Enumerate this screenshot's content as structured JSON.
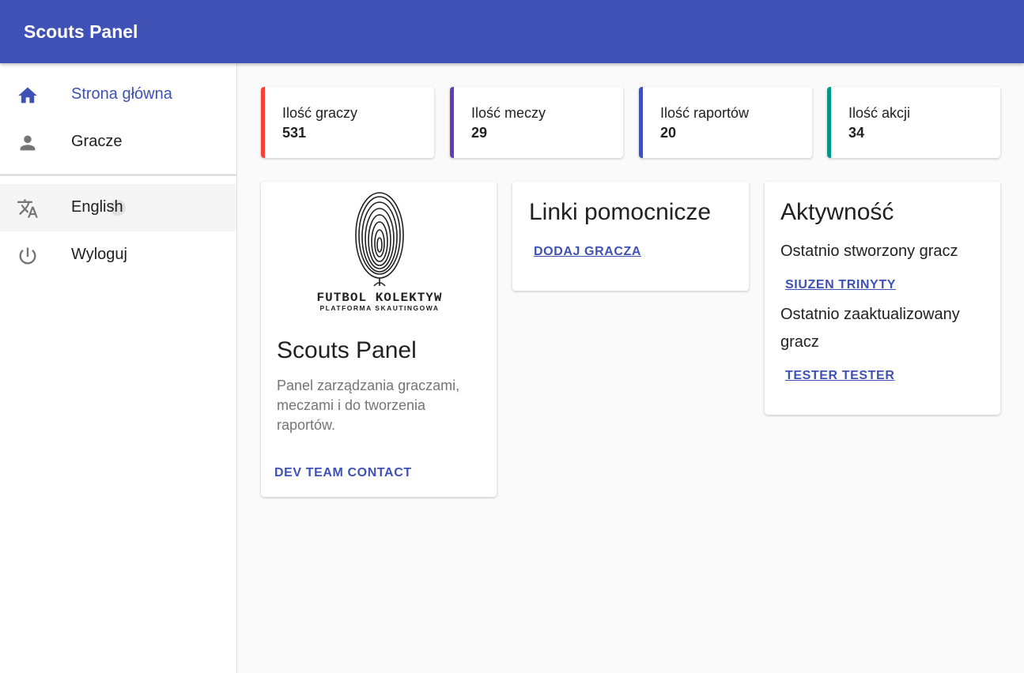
{
  "app": {
    "title": "Scouts Panel"
  },
  "sidebar": {
    "items": [
      {
        "label": "Strona główna",
        "icon": "home-icon"
      },
      {
        "label": "Gracze",
        "icon": "person-icon"
      },
      {
        "label": "English",
        "icon": "translate-icon"
      },
      {
        "label": "Wyloguj",
        "icon": "power-icon"
      }
    ]
  },
  "stats": [
    {
      "label": "Ilość graczy",
      "value": "531",
      "color": "#f44336"
    },
    {
      "label": "Ilość meczy",
      "value": "29",
      "color": "#673ab7"
    },
    {
      "label": "Ilość raportów",
      "value": "20",
      "color": "#3f51b5"
    },
    {
      "label": "Ilość akcji",
      "value": "34",
      "color": "#009688"
    }
  ],
  "about_card": {
    "logo_text": "FUTBOL KOLEKTYW",
    "logo_subtext": "PLATFORMA SKAUTINGOWA",
    "title": "Scouts Panel",
    "description": "Panel zarządzania graczami, meczami i do tworzenia raportów.",
    "contact_button": "Dev team contact"
  },
  "links_card": {
    "title": "Linki pomocnicze",
    "add_player_link": "DODAJ GRACZA"
  },
  "activity_card": {
    "title": "Aktywność",
    "last_created_label": "Ostatnio stworzony gracz",
    "last_created_player": "SIUZEN TRINYTY",
    "last_updated_label": "Ostatnio zaaktualizowany gracz",
    "last_updated_player": "TESTER TESTER"
  },
  "colors": {
    "primary": "#3f51b5"
  }
}
